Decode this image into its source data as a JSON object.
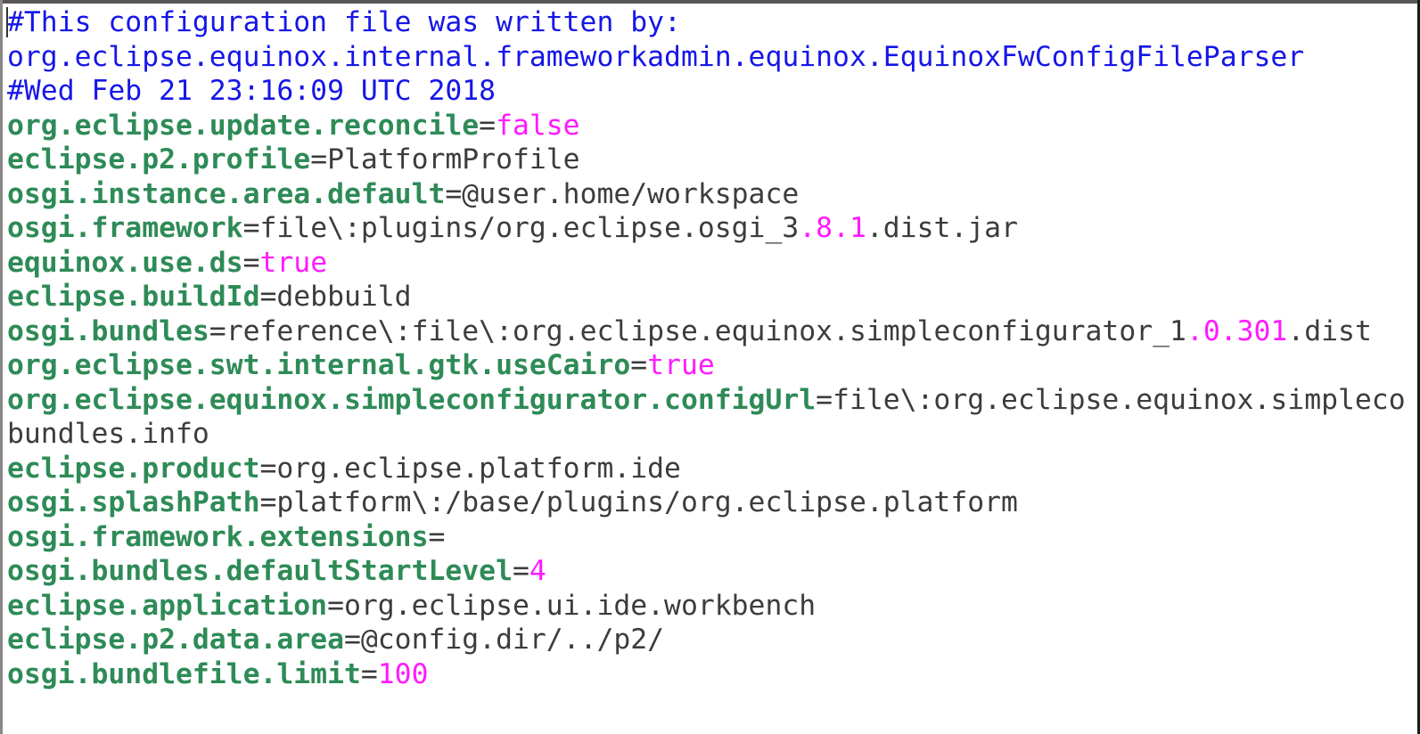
{
  "editor": {
    "lines": [
      [
        {
          "t": "#This configuration file was written by:",
          "c": "c"
        }
      ],
      [
        {
          "t": "org.eclipse.equinox.internal.frameworkadmin.equinox.EquinoxFwConfigFileParser",
          "c": "c"
        }
      ],
      [
        {
          "t": "#Wed Feb 21 23:16:09 UTC 2018",
          "c": "c"
        }
      ],
      [
        {
          "t": "org.eclipse.update.reconcile",
          "c": "k"
        },
        {
          "t": "=",
          "c": "v"
        },
        {
          "t": "false",
          "c": "n"
        }
      ],
      [
        {
          "t": "eclipse.p2.profile",
          "c": "k"
        },
        {
          "t": "=PlatformProfile",
          "c": "v"
        }
      ],
      [
        {
          "t": "osgi.instance.area.default",
          "c": "k"
        },
        {
          "t": "=@user.home/workspace",
          "c": "v"
        }
      ],
      [
        {
          "t": "osgi.framework",
          "c": "k"
        },
        {
          "t": "=file\\:plugins/org.eclipse.osgi_3",
          "c": "v"
        },
        {
          "t": ".8.1",
          "c": "n"
        },
        {
          "t": ".dist.jar",
          "c": "v"
        }
      ],
      [
        {
          "t": "equinox.use.ds",
          "c": "k"
        },
        {
          "t": "=",
          "c": "v"
        },
        {
          "t": "true",
          "c": "n"
        }
      ],
      [
        {
          "t": "eclipse.buildId",
          "c": "k"
        },
        {
          "t": "=debbuild",
          "c": "v"
        }
      ],
      [
        {
          "t": "osgi.bundles",
          "c": "k"
        },
        {
          "t": "=reference\\:file\\:org.eclipse.equinox.simpleconfigurator_1",
          "c": "v"
        },
        {
          "t": ".0.301",
          "c": "n"
        },
        {
          "t": ".dist",
          "c": "v"
        }
      ],
      [
        {
          "t": "org.eclipse.swt.internal.gtk.useCairo",
          "c": "k"
        },
        {
          "t": "=",
          "c": "v"
        },
        {
          "t": "true",
          "c": "n"
        }
      ],
      [
        {
          "t": "org.eclipse.equinox.simpleconfigurator.configUrl",
          "c": "k"
        },
        {
          "t": "=file\\:org.eclipse.equinox.simpleco",
          "c": "v"
        }
      ],
      [
        {
          "t": "bundles.info",
          "c": "v"
        }
      ],
      [
        {
          "t": "eclipse.product",
          "c": "k"
        },
        {
          "t": "=org.eclipse.platform.ide",
          "c": "v"
        }
      ],
      [
        {
          "t": "osgi.splashPath",
          "c": "k"
        },
        {
          "t": "=platform\\:/base/plugins/org.eclipse.platform",
          "c": "v"
        }
      ],
      [
        {
          "t": "osgi.framework.extensions",
          "c": "k"
        },
        {
          "t": "=",
          "c": "v"
        }
      ],
      [
        {
          "t": "osgi.bundles.defaultStartLevel",
          "c": "k"
        },
        {
          "t": "=",
          "c": "v"
        },
        {
          "t": "4",
          "c": "n"
        }
      ],
      [
        {
          "t": "eclipse.application",
          "c": "k"
        },
        {
          "t": "=org.eclipse.ui.ide.workbench",
          "c": "v"
        }
      ],
      [
        {
          "t": "eclipse.p2.data.area",
          "c": "k"
        },
        {
          "t": "=@config.dir/../p2/",
          "c": "v"
        }
      ],
      [
        {
          "t": "osgi.bundlefile.limit",
          "c": "k"
        },
        {
          "t": "=",
          "c": "v"
        },
        {
          "t": "100",
          "c": "n"
        }
      ]
    ]
  },
  "colors": {
    "comment": "#1616e8",
    "key": "#2e8b57",
    "value": "#3c3c3c",
    "literal": "#ff1aff"
  }
}
